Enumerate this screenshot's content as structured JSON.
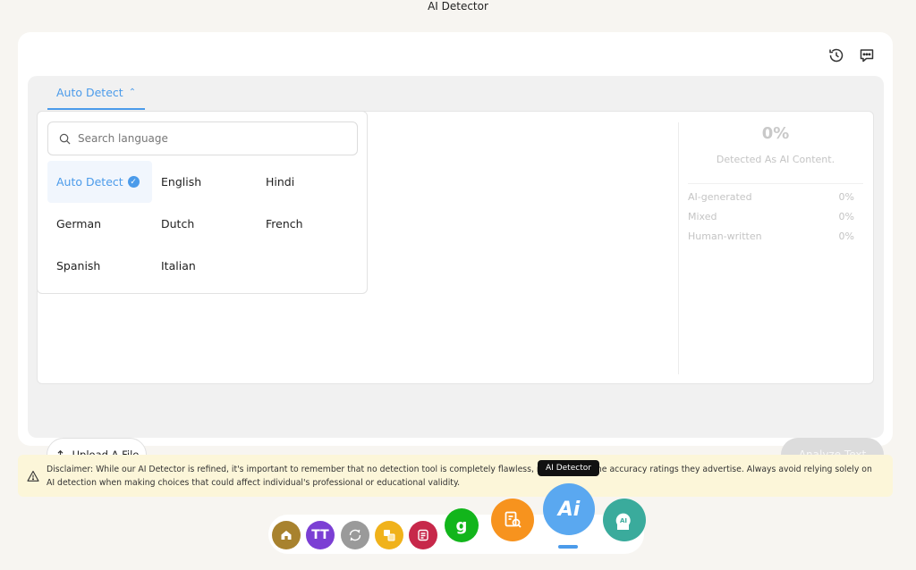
{
  "app": {
    "title": "AI Detector"
  },
  "toolbar": {
    "history_icon": "history-icon",
    "feedback_icon": "chat-icon"
  },
  "language": {
    "tab_label": "Auto Detect",
    "search_placeholder": "Search language",
    "options": [
      "Auto Detect",
      "English",
      "Hindi",
      "German",
      "Dutch",
      "French",
      "Spanish",
      "Italian"
    ],
    "selected": "Auto Detect"
  },
  "result": {
    "percent": "0%",
    "caption": "Detected As AI Content.",
    "stats": [
      {
        "label": "AI-generated",
        "value": "0%"
      },
      {
        "label": "Mixed",
        "value": "0%"
      },
      {
        "label": "Human-written",
        "value": "0%"
      }
    ]
  },
  "actions": {
    "upload_label": "Upload A File",
    "analyze_label": "Analyze Text"
  },
  "disclaimer": {
    "text": "Disclaimer: While our AI Detector is refined, it's important to remember that no detection tool is completely flawless, regardless of the accuracy ratings they advertise. Always avoid relying solely on AI detection when making choices that could affect individual's professional or educational validity."
  },
  "dock": {
    "tooltip": "AI Detector",
    "tools": [
      {
        "icon": "hat-icon",
        "color": "#a8822e"
      },
      {
        "icon": "text-size-icon",
        "label": "TT",
        "color": "#7b3fd4"
      },
      {
        "icon": "paraphrase-icon",
        "color": "#9a9a9a"
      },
      {
        "icon": "translate-icon",
        "color": "#f0b21b"
      },
      {
        "icon": "summarizer-icon",
        "color": "#c7284a"
      },
      {
        "icon": "grammar-icon",
        "label": "g",
        "color": "#12b51b"
      },
      {
        "icon": "plagiarism-icon",
        "color": "#f7931e"
      },
      {
        "icon": "ai-detector-icon",
        "label": "Ai",
        "color": "#5aa8f0"
      },
      {
        "icon": "ai-humanizer-icon",
        "label": "AI",
        "color": "#3aab9c"
      }
    ]
  }
}
